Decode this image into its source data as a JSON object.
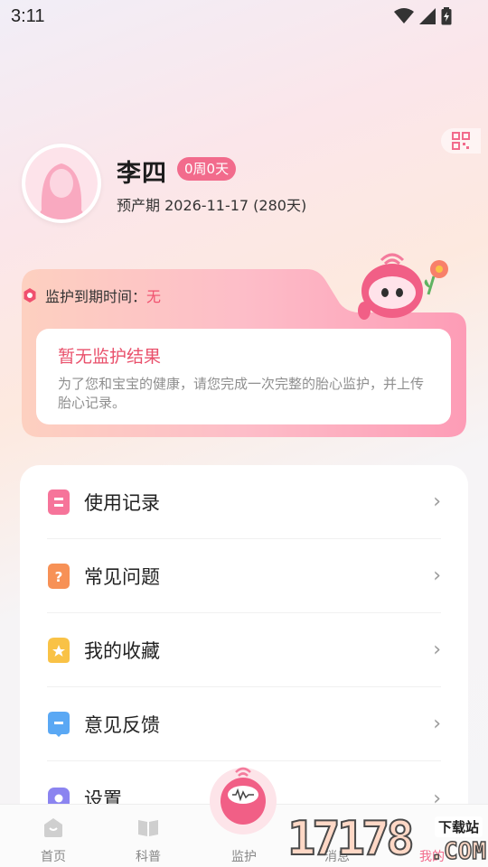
{
  "status_bar": {
    "time": "3:11"
  },
  "profile": {
    "name": "李四",
    "week_badge": "0周0天",
    "due_date": "预产期 2026-11-17 (280天)"
  },
  "monitor": {
    "expire_label": "监护到期时间：",
    "expire_value": "无",
    "no_result_title": "暂无监护结果",
    "no_result_desc": "为了您和宝宝的健康，请您完成一次完整的胎心监护，并上传胎心记录。"
  },
  "menu": {
    "items": [
      {
        "label": "使用记录",
        "icon": "record-icon",
        "color": "#f6749a"
      },
      {
        "label": "常见问题",
        "icon": "question-icon",
        "color": "#f79156"
      },
      {
        "label": "我的收藏",
        "icon": "star-icon",
        "color": "#f9c246"
      },
      {
        "label": "意见反馈",
        "icon": "feedback-icon",
        "color": "#5aa8f4"
      },
      {
        "label": "设置",
        "icon": "settings-icon",
        "color": "#8b84f0"
      }
    ]
  },
  "bottom_nav": {
    "items": [
      {
        "label": "首页",
        "icon": "home-icon"
      },
      {
        "label": "科普",
        "icon": "book-icon"
      },
      {
        "label": "监护",
        "icon": "monitor-icon"
      },
      {
        "label": "消息",
        "icon": "message-icon"
      },
      {
        "label": "我的",
        "icon": "profile-icon"
      }
    ]
  },
  "watermark": {
    "number": "17178",
    "tag": "下载站",
    "domain": ".COM"
  },
  "colors": {
    "accent": "#f26b8c",
    "warning": "#f0506e"
  }
}
